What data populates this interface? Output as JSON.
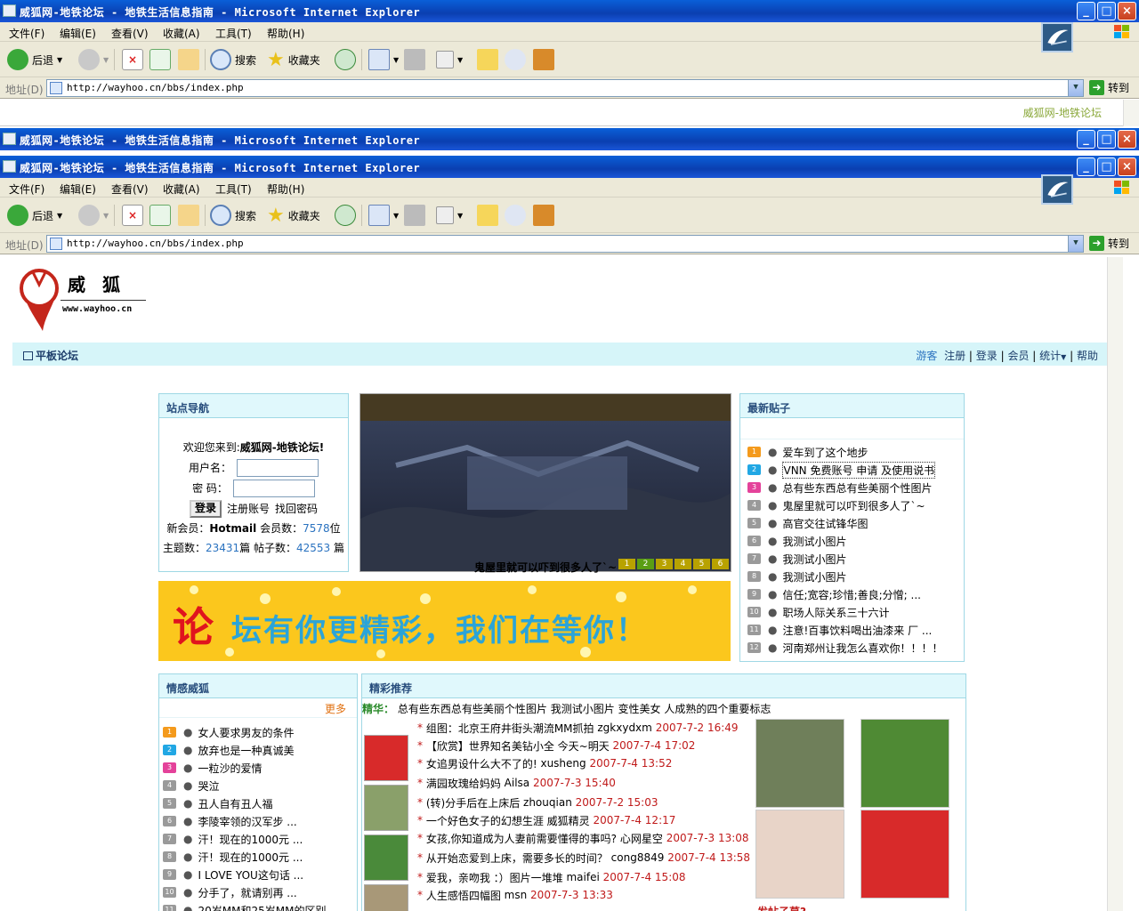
{
  "window": {
    "title": "威狐网-地铁论坛 - 地铁生活信息指南 - Microsoft Internet Explorer",
    "buttons": {
      "minimize": "_",
      "maximize": "□",
      "close": "×"
    }
  },
  "menu": {
    "items": [
      "文件(F)",
      "编辑(E)",
      "查看(V)",
      "收藏(A)",
      "工具(T)",
      "帮助(H)"
    ]
  },
  "toolbar": {
    "back": "后退",
    "search": "搜索",
    "favorites": "收藏夹"
  },
  "address": {
    "label": "地址(D)",
    "url": "http://wayhoo.cn/bbs/index.php",
    "go": "转到"
  },
  "ghost_page": {
    "link_text": "威狐网-地铁论坛"
  },
  "site": {
    "logo_text": "威 狐",
    "logo_url": "www.wayhoo.cn",
    "forum_mode": "平板论坛",
    "nav": {
      "guest": "游客",
      "register": "注册",
      "login": "登录",
      "members": "会员",
      "stats": "统计",
      "help": "帮助"
    }
  },
  "nav_panel": {
    "title": "站点导航",
    "welcome_prefix": "欢迎您来到:",
    "welcome_name": "威狐网-地铁论坛!",
    "username_label": "用户名：",
    "password_label": "密 码：",
    "login_button": "登录",
    "register_link": "注册账号",
    "forgot_link": "找回密码",
    "newmember_label": "新会员：",
    "newmember": "Hotmail",
    "members_label": "会员数：",
    "members": "7578",
    "members_unit": "位",
    "topics_label": "主题数：",
    "topics": "23431",
    "topics_unit": "篇",
    "posts_label": "帖子数：",
    "posts": "42553",
    "posts_unit": "篇"
  },
  "slideshow": {
    "caption": "鬼屋里就可以吓到很多人了`~",
    "pages": [
      "1",
      "2",
      "3",
      "4",
      "5",
      "6"
    ],
    "active": 1
  },
  "banner": {
    "text_red": "论",
    "text_blue": "坛有你更精彩，我们在等你！"
  },
  "latest": {
    "title": "最新贴子",
    "items": [
      "爱车到了这个地步",
      "VNN 免费账号 申请 及使用说书",
      "总有些东西总有些美丽个性图片",
      "鬼屋里就可以吓到很多人了`~",
      "高官交往试锋华图",
      "我测试小图片",
      "我测试小图片",
      "我测试小图片",
      "信任;宽容;珍惜;善良;分憎; ...",
      "职场人际关系三十六计",
      "注意!百事饮料喝出油漆来 厂 ...",
      "河南郑州让我怎么喜欢你！！！！"
    ]
  },
  "emotion": {
    "title": "情感威狐",
    "more": "更多",
    "items": [
      "女人要求男友的条件",
      "放弃也是一种真诚美",
      "一粒沙的爱情",
      "哭泣",
      "丑人自有丑人福",
      "李陵宰领的汉军步 ...",
      "汗！现在的1000元 ...",
      "汗！现在的1000元 ...",
      "I LOVE YOU这句话 ...",
      "分手了，就请别再 ...",
      "20岁MM和25岁MM的区别"
    ]
  },
  "featured": {
    "title": "精彩推荐",
    "digest_label": "精华：",
    "digest_links": [
      "总有些东西总有些美丽个性图片",
      "我测试小图片",
      "变性美女",
      "人成熟的四个重要标志"
    ],
    "items": [
      {
        "title": "组图：北京王府井街头潮流MM抓拍",
        "author": "zgkxydxm",
        "date": "2007-7-2 16:49"
      },
      {
        "title": "【欣赏】世界知名美钻小全 今天~明天",
        "author": "",
        "date": "2007-7-4 17:02"
      },
      {
        "title": "女追男设什么大不了的!",
        "author": "xusheng",
        "date": "2007-7-4 13:52"
      },
      {
        "title": "满园玫瑰给妈妈",
        "author": "Ailsa",
        "date": "2007-7-3 15:40"
      },
      {
        "title": "(转)分手后在上床后",
        "author": "zhouqian",
        "date": "2007-7-2 15:03"
      },
      {
        "title": "一个好色女子的幻想生涯",
        "author": "威狐精灵",
        "date": "2007-7-4 12:17"
      },
      {
        "title": "女孩,你知道成为人妻前需要懂得的事吗?",
        "author": "心网星空",
        "date": "2007-7-3 13:08"
      },
      {
        "title": "从开始恋爱到上床，需要多长的时间？",
        "author": "cong8849",
        "date": "2007-7-4 13:58"
      },
      {
        "title": "爱我，亲吻我 ：）图片一堆堆",
        "author": "maifei",
        "date": "2007-7-4 15:08"
      },
      {
        "title": "人生感悟四幅图",
        "author": "msn",
        "date": "2007-7-3 13:33"
      }
    ],
    "cutoff_label": "发帖子莫?"
  },
  "colors": {
    "title_blue": "#0a47c2",
    "panel_head": "#e0f8fc",
    "link_blue": "#2b73c0",
    "accent_red": "#c01a1a"
  }
}
